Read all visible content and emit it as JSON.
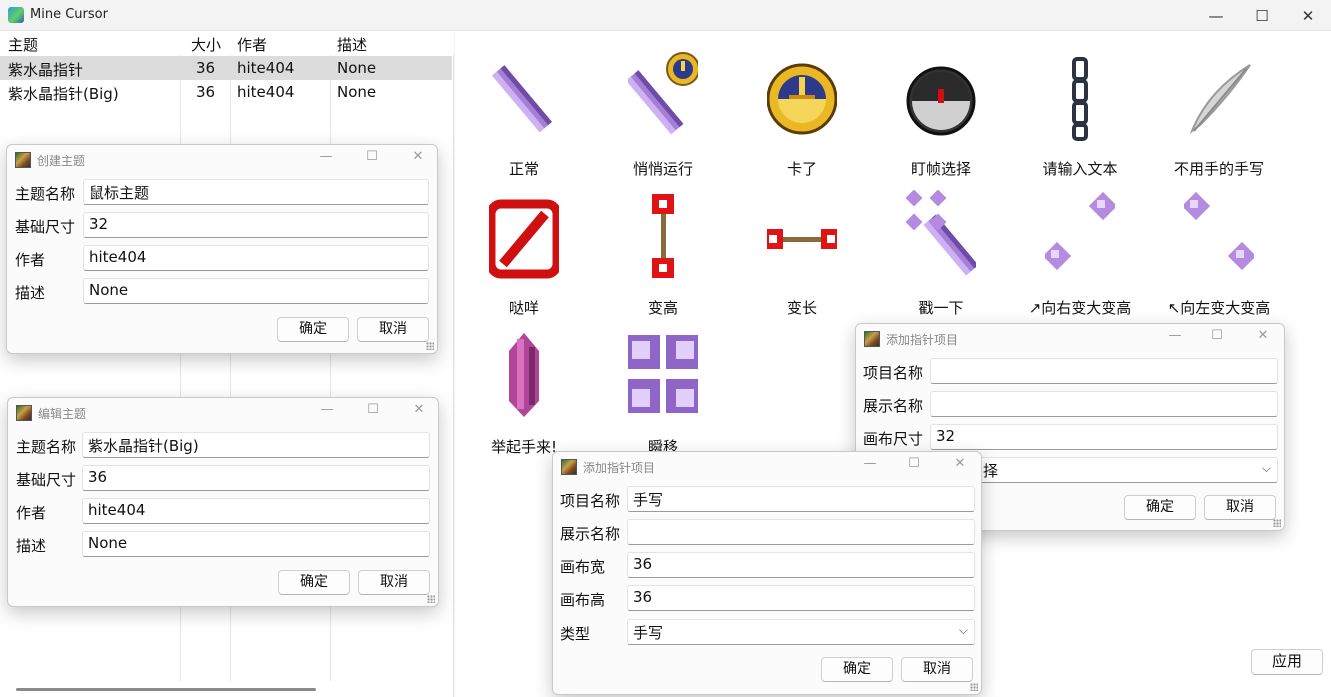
{
  "window": {
    "title": "Mine Cursor",
    "minimize": "—",
    "maximize": "☐",
    "close": "✕"
  },
  "table": {
    "headers": [
      "主题",
      "大小",
      "作者",
      "描述"
    ],
    "rows": [
      {
        "name": "紫水晶指针",
        "size": "36",
        "author": "hite404",
        "desc": "None"
      },
      {
        "name": "紫水晶指针(Big)",
        "size": "36",
        "author": "hite404",
        "desc": "None"
      }
    ]
  },
  "gallery": {
    "cursors": [
      {
        "label": "正常",
        "icon": "amethyst-shard-icon"
      },
      {
        "label": "悄悄运行",
        "icon": "amethyst-clock-icon"
      },
      {
        "label": "卡了",
        "icon": "clock-icon"
      },
      {
        "label": "盯帧选择",
        "icon": "compass-icon"
      },
      {
        "label": "请输入文本",
        "icon": "chain-icon"
      },
      {
        "label": "不用手的手写",
        "icon": "feather-icon"
      },
      {
        "label": "哒咩",
        "icon": "barrier-icon"
      },
      {
        "label": "变高",
        "icon": "vertical-resize-icon"
      },
      {
        "label": "变长",
        "icon": "horizontal-resize-icon"
      },
      {
        "label": "戳一下",
        "icon": "amethyst-poke-icon"
      },
      {
        "label": "↗向右变大变高",
        "icon": "diagonal-resize-ne-icon"
      },
      {
        "label": "↖向左变大变高",
        "icon": "diagonal-resize-nw-icon"
      },
      {
        "label": "举起手来!",
        "icon": "amethyst-bud-icon"
      },
      {
        "label": "瞬移",
        "icon": "amethyst-move-icon"
      }
    ],
    "apply_label": "应用"
  },
  "dialog_create": {
    "title": "创建主题",
    "fields": [
      {
        "label": "主题名称",
        "value": "鼠标主题"
      },
      {
        "label": "基础尺寸",
        "value": "32"
      },
      {
        "label": "作者",
        "value": "hite404"
      },
      {
        "label": "描述",
        "value": "None"
      }
    ],
    "ok": "确定",
    "cancel": "取消"
  },
  "dialog_edit": {
    "title": "编辑主题",
    "fields": [
      {
        "label": "主题名称",
        "value": "紫水晶指针(Big)"
      },
      {
        "label": "基础尺寸",
        "value": "36"
      },
      {
        "label": "作者",
        "value": "hite404"
      },
      {
        "label": "描述",
        "value": "None"
      }
    ],
    "ok": "确定",
    "cancel": "取消"
  },
  "dialog_add_a": {
    "title": "添加指针项目",
    "fields": [
      {
        "label": "项目名称",
        "value": ""
      },
      {
        "label": "展示名称",
        "value": ""
      },
      {
        "label": "画布尺寸",
        "value": "32"
      }
    ],
    "select_value_visible": "择",
    "ok": "确定",
    "cancel": "取消"
  },
  "dialog_add_b": {
    "title": "添加指针项目",
    "fields": [
      {
        "label": "项目名称",
        "value": "手写"
      },
      {
        "label": "展示名称",
        "value": ""
      },
      {
        "label": "画布宽",
        "value": "36"
      },
      {
        "label": "画布高",
        "value": "36"
      },
      {
        "label": "类型",
        "value": "手写"
      }
    ],
    "ok": "确定",
    "cancel": "取消"
  },
  "colors": {
    "amethyst": "#b48be0",
    "amethyst_dark": "#6e4ca8",
    "selection": "#dcdcdc",
    "barrier_red": "#d01010"
  }
}
